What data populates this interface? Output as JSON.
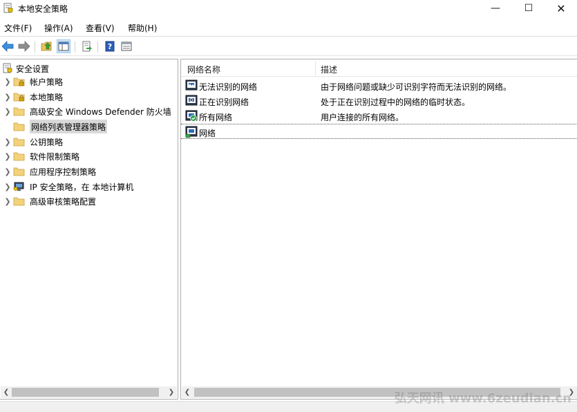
{
  "window": {
    "title": "本地安全策略",
    "minimize_glyph": "—",
    "maximize_glyph": "☐",
    "close_glyph": "✕"
  },
  "menu": [
    "文件(F)",
    "操作(A)",
    "查看(V)",
    "帮助(H)"
  ],
  "toolbar": {
    "buttons": [
      "back-icon",
      "forward-icon",
      "up-folder-icon",
      "show-tree-icon",
      "export-list-icon",
      "help-icon",
      "properties-view-icon"
    ]
  },
  "tree": {
    "root": "安全设置",
    "items": [
      {
        "label": "帐户策略",
        "icon": "folder-lock-icon",
        "expandable": true
      },
      {
        "label": "本地策略",
        "icon": "folder-lock-icon",
        "expandable": true
      },
      {
        "label": "高级安全 Windows Defender 防火墙",
        "icon": "folder-icon",
        "expandable": true
      },
      {
        "label": "网络列表管理器策略",
        "icon": "folder-icon",
        "expandable": false,
        "selected": true
      },
      {
        "label": "公钥策略",
        "icon": "folder-icon",
        "expandable": true
      },
      {
        "label": "软件限制策略",
        "icon": "folder-icon",
        "expandable": true
      },
      {
        "label": "应用程序控制策略",
        "icon": "folder-icon",
        "expandable": true
      },
      {
        "label": "IP 安全策略，在 本地计算机",
        "icon": "ip-security-icon",
        "expandable": true
      },
      {
        "label": "高级审核策略配置",
        "icon": "folder-icon",
        "expandable": true
      }
    ]
  },
  "list": {
    "columns": [
      "网络名称",
      "描述"
    ],
    "rows": [
      {
        "name": "无法识别的网络",
        "desc": "由于网络问题或缺少可识别字符而无法识别的网络。",
        "icon": "unidentified-network-icon"
      },
      {
        "name": "正在识别网络",
        "desc": "处于正在识别过程中的网络的临时状态。",
        "icon": "identifying-network-icon"
      },
      {
        "name": "所有网络",
        "desc": "用户连接的所有网络。",
        "icon": "all-networks-icon"
      },
      {
        "name": "网络",
        "desc": "",
        "icon": "network-icon"
      }
    ]
  },
  "watermark": "弘天网讯 www.6zeudian.cn",
  "colors": {
    "selection": "#d9d9d9",
    "toolbar_active": "#cce4f7",
    "border": "#adadad"
  }
}
